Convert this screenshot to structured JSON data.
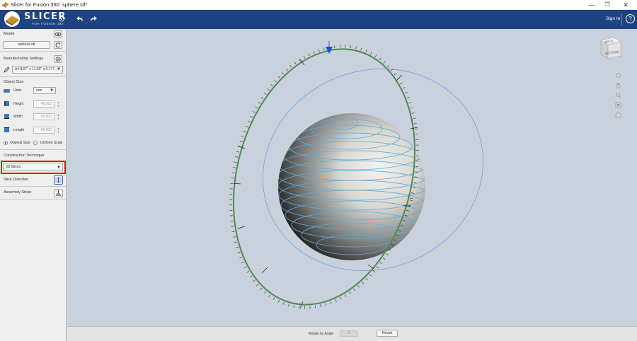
{
  "window": {
    "title": "Slicer for Fusion 360: sphere.stl*",
    "minimize": "—",
    "maximize": "❐",
    "close": "✕"
  },
  "header": {
    "logo_text": "SLICER",
    "logo_sub": "FOR FUSION 360",
    "sign_in": "Sign In",
    "help": "?"
  },
  "sidebar": {
    "model": {
      "label": "Model",
      "file": "sphere.stl"
    },
    "manufacturing": {
      "label": "Manufacturing Settings",
      "sheet": "A4 8.27\" x 11.69\" x 0.177..."
    },
    "object_size": {
      "label": "Object Size",
      "units_label": "Units",
      "units_value": "mm",
      "height_label": "Height",
      "height_value": "49.993",
      "width_label": "Width",
      "width_value": "50.000",
      "length_label": "Length",
      "length_value": "50.000",
      "original_size": "Original Size",
      "uniform_scale": "Uniform Scale"
    },
    "construction": {
      "label": "Construction Technique",
      "value": "3D Slices"
    },
    "slice_direction": {
      "label": "Slice Direction"
    },
    "assembly": {
      "label": "Assembly Steps"
    }
  },
  "bottom": {
    "rotate_label": "Rotate by  Angle",
    "rotate_value": "0",
    "reset": "Reset"
  },
  "viewcube": {
    "face_top": "BACK",
    "face_front": "BOTTOM"
  },
  "colors": {
    "header_blue": "#1d4383",
    "viewport_bg": "#c9d2dc",
    "highlight_red": "#e3141c",
    "slice_lines": "#5aaee0",
    "rotation_ring": "#4f8a55"
  }
}
